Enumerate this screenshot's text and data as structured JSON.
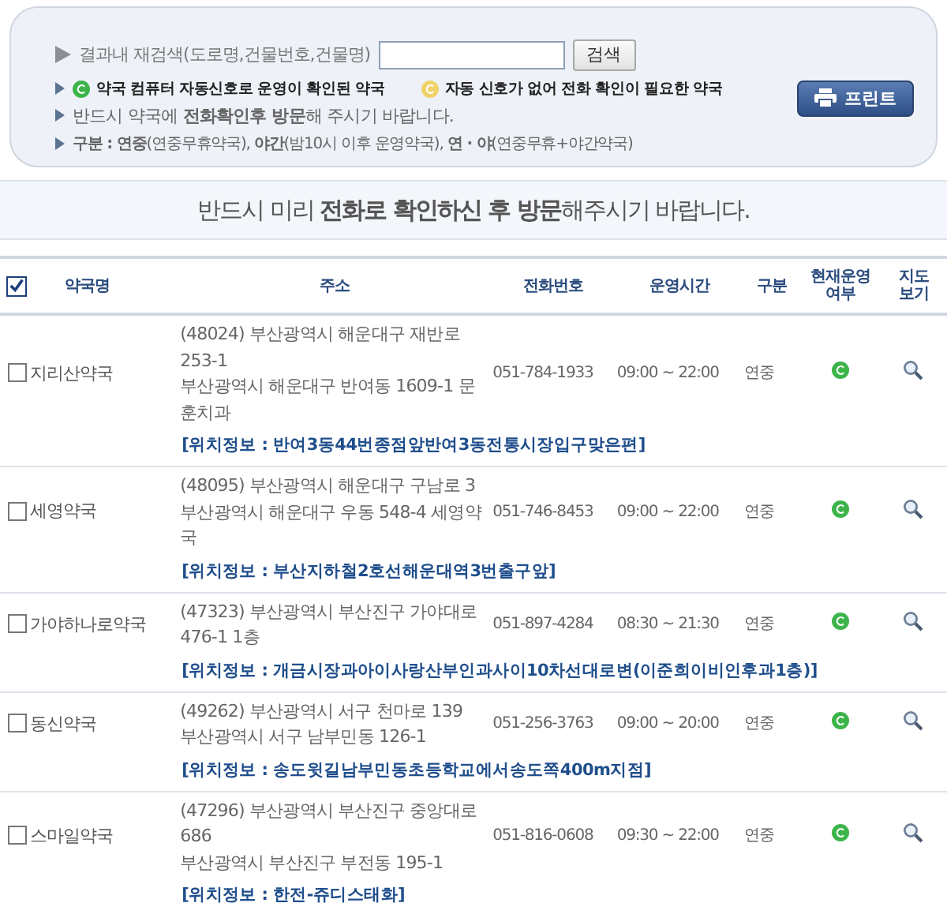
{
  "search": {
    "label": "결과내 재검색(도로명,건물번호,건물명)",
    "button": "검색"
  },
  "legend": [
    {
      "kind": "status",
      "color": "#3cb44a",
      "text": "약국 컴퓨터 자동신호로 운영이 확인된 약국"
    },
    {
      "kind": "status",
      "color": "#f1d36a",
      "text": "자동 신호가 없어 전화 확인이 필요한 약국"
    },
    {
      "kind": "notice",
      "text": "반드시 약국에 **전화확인후 방문**해 주시기 바랍니다."
    },
    {
      "kind": "types",
      "text": "**구분 : 연중**(연중무휴약국), **야간**(밤10시 이후 운영약국), **연 · 야**(연중무휴+야간약국)"
    }
  ],
  "print_button": "프린트",
  "banner": "반드시 미리 **전화로 확인하신 후 방문**해주시기 바랍니다.",
  "table": {
    "all_checked": true,
    "columns": [
      "약국명",
      "주소",
      "전화번호",
      "운영시간",
      "구분",
      "현재운영 여부",
      "지도 보기"
    ],
    "rows": [
      {
        "name": "지리산약국",
        "checked": false,
        "address": [
          "(48024) 부산광역시 해운대구 재반로 253-1",
          "부산광역시 해운대구 반여동 1609-1 문훈치과"
        ],
        "phone": "051-784-1933",
        "hours": "09:00 ~ 22:00",
        "type": "연중",
        "color": "#3cb44a",
        "location": "[위치정보 : 반여3동44번종점앞반여3동전통시장입구맞은편]"
      },
      {
        "name": "세영약국",
        "checked": false,
        "address": [
          "(48095) 부산광역시 해운대구 구남로 3",
          "부산광역시 해운대구 우동 548-4 세영약국"
        ],
        "phone": "051-746-8453",
        "hours": "09:00 ~ 22:00",
        "type": "연중",
        "color": "#3cb44a",
        "location": "[위치정보 : 부산지하철2호선해운대역3번출구앞]"
      },
      {
        "name": "가야하나로약국",
        "checked": false,
        "address": [
          "(47323) 부산광역시 부산진구 가야대로 476-1 1층"
        ],
        "phone": "051-897-4284",
        "hours": "08:30 ~ 21:30",
        "type": "연중",
        "color": "#3cb44a",
        "location": "[위치정보 : 개금시장과아이사랑산부인과사이10차선대로변(이준희이비인후과1층)]"
      },
      {
        "name": "동신약국",
        "checked": false,
        "address": [
          "(49262) 부산광역시 서구 천마로 139",
          "부산광역시 서구 남부민동 126-1"
        ],
        "phone": "051-256-3763",
        "hours": "09:00 ~ 20:00",
        "type": "연중",
        "color": "#3cb44a",
        "location": "[위치정보 : 송도윗길남부민동초등학교에서송도쪽400m지점]"
      },
      {
        "name": "스마일약국",
        "checked": false,
        "address": [
          "(47296) 부산광역시 부산진구 중앙대로 686",
          "부산광역시 부산진구 부전동 195-1"
        ],
        "phone": "051-816-0608",
        "hours": "09:30 ~ 22:00",
        "type": "연중",
        "color": "#3cb44a",
        "location": "[위치정보 : 한전-쥬디스태화]"
      }
    ]
  }
}
